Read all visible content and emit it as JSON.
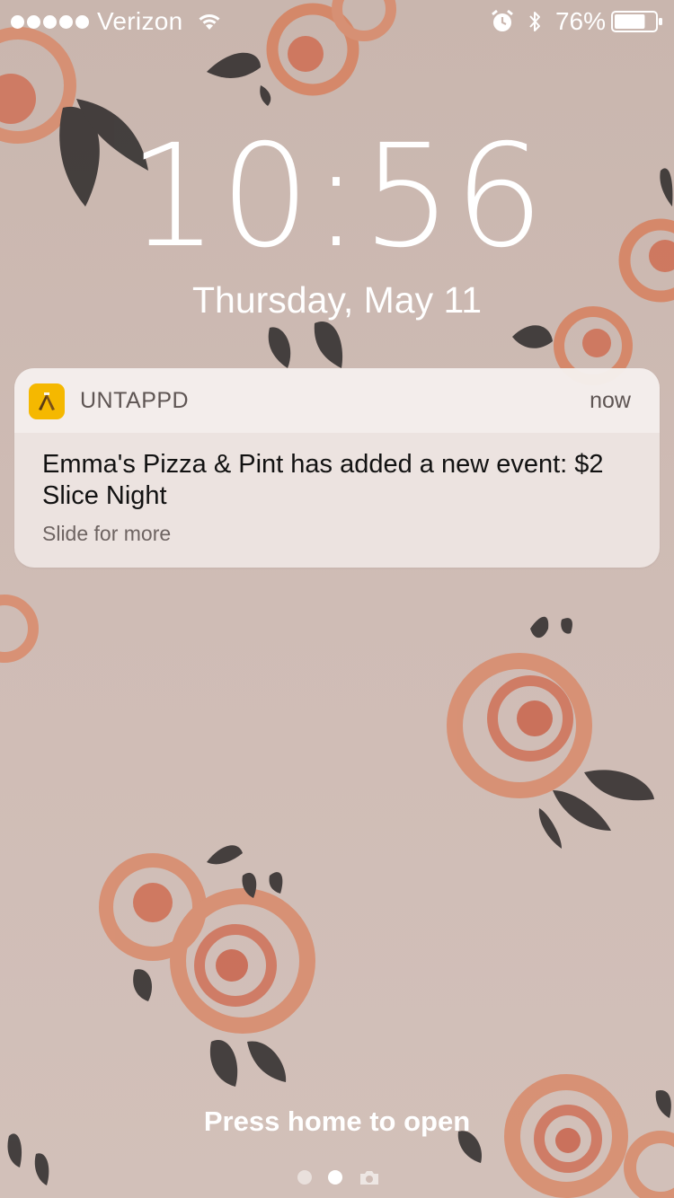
{
  "status_bar": {
    "carrier": "Verizon",
    "signal_bars": 5,
    "battery_percent": "76%",
    "battery_level": 0.76,
    "icons": [
      "signal-dots-icon",
      "wifi-icon",
      "alarm-icon",
      "bluetooth-icon",
      "battery-icon"
    ]
  },
  "lock_screen": {
    "time": "10:56",
    "date": "Thursday, May 11"
  },
  "notification": {
    "app_name": "UNTAPPD",
    "app_icon": "untappd-app-icon",
    "app_icon_color": "#f5b800",
    "time": "now",
    "message": "Emma's Pizza & Pint has added a new event: $2 Slice Night",
    "hint": "Slide for more"
  },
  "footer": {
    "prompt": "Press home to open",
    "page_count": 2,
    "active_page": 2,
    "icons": [
      "camera-icon"
    ]
  }
}
